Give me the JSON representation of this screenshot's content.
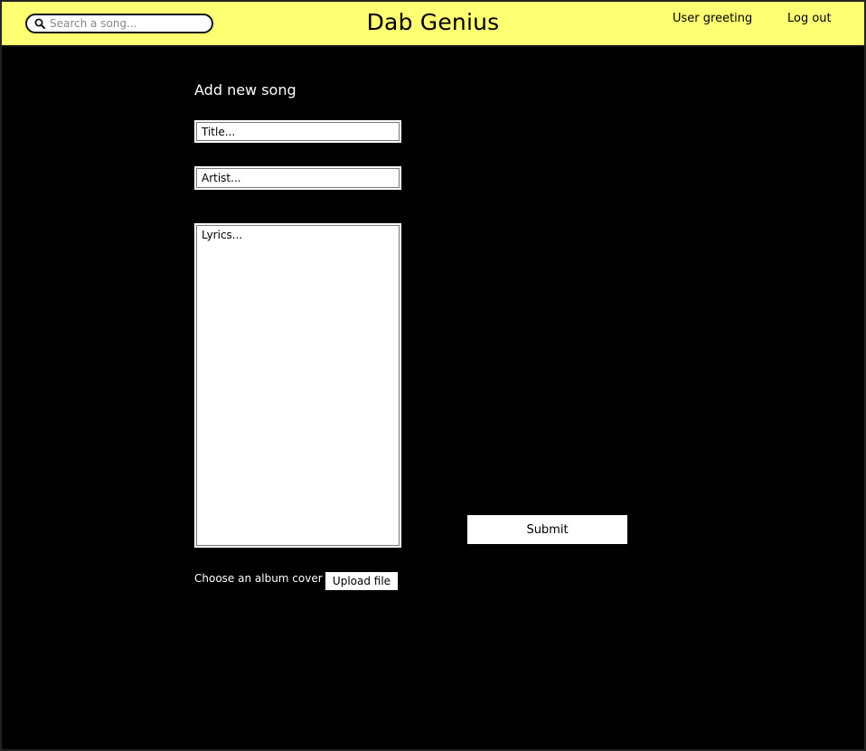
{
  "header": {
    "background_color": "#ffff73",
    "search": {
      "placeholder": "Search a song...",
      "icon": "search-icon"
    },
    "app_title": "Dab Genius",
    "user_greeting": "User greeting",
    "logout_label": "Log out"
  },
  "form": {
    "heading": "Add new song",
    "title_placeholder": "Title...",
    "artist_placeholder": "Artist...",
    "lyrics_placeholder": "Lyrics...",
    "submit_label": "Submit",
    "cover_label": "Choose an album cover",
    "upload_label": "Upload file"
  },
  "page": {
    "background_color": "#000000"
  }
}
